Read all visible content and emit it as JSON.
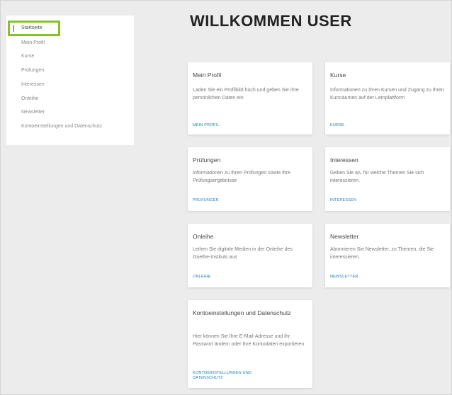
{
  "page": {
    "title": "WILLKOMMEN USER"
  },
  "sidebar": {
    "active": "Startseite",
    "items": [
      "Mein Profil",
      "Kurse",
      "Prüfungen",
      "Interessen",
      "Onleihe",
      "Newsletter",
      "Kontoeinstellungen und Datenschutz"
    ]
  },
  "cards": {
    "profil": {
      "title": "Mein Profil",
      "text": "Laden Sie ein Profilbild hoch und geben Sie Ihre persönlichen Daten ein",
      "link": "MEIN PROFIL"
    },
    "kurse": {
      "title": "Kurse",
      "text": "Informationen zu Ihren Kursen und Zugang zu Ihren Kursräumen auf der Lernplattform",
      "link": "KURSE"
    },
    "pruefungen": {
      "title": "Prüfungen",
      "text": "Informationen zu Ihren Prüfungen sowie Ihre Prüfungsergebnisse",
      "link": "PRÜFUNGEN"
    },
    "interessen": {
      "title": "Interessen",
      "text": "Geben Sie an, für welche Themen Sie sich interessieren.",
      "link": "INTERESSEN"
    },
    "onleihe": {
      "title": "Onleihe",
      "text": "Leihen Sie digitale Medien in der Onleihe des Goethe-Instituts aus",
      "link": "ONLEIHE"
    },
    "newsletter": {
      "title": "Newsletter",
      "text": "Abonnieren Sie Newsletter, zu Themen, die Sie interessieren.",
      "link": "NEWSLETTER"
    },
    "konto": {
      "title": "Kontoeinstellungen und Datenschutz",
      "text": "Hier können Sie Ihre E-Mail-Adresse und Ihr Passwort ändern oder Ihre Kontodaten exportieren",
      "link": "KONTOEINSTELLUNGEN UND DATENSCHUTZ"
    }
  },
  "colors": {
    "accent": "#86c129",
    "link": "#1a7bb8",
    "background": "#ececec"
  }
}
